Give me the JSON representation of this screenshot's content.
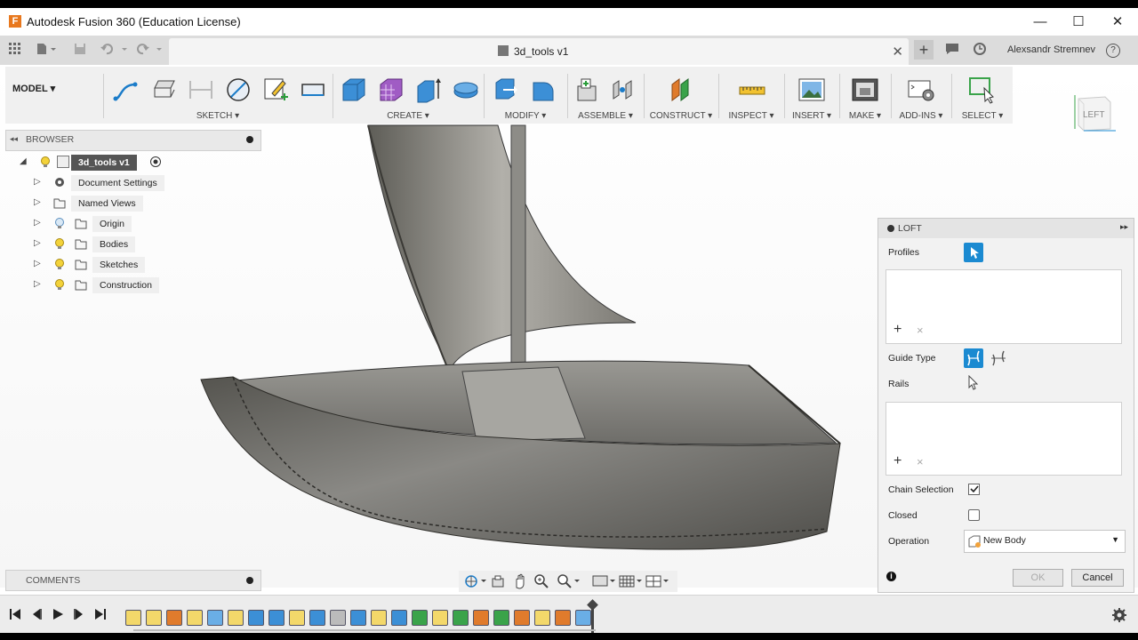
{
  "window": {
    "title": "Autodesk Fusion 360 (Education License)",
    "controls": {
      "minimize": "—",
      "maximize": "☐",
      "close": "✕"
    }
  },
  "tabbar": {
    "document_title": "3d_tools v1",
    "close_glyph": "✕",
    "new_tab_glyph": "+",
    "user_name": "Alexsandr Stremnev",
    "help_glyph": "?"
  },
  "toolbar": {
    "workspace": "MODEL ▾",
    "groups": [
      {
        "label": "SKETCH ▾"
      },
      {
        "label": "CREATE ▾"
      },
      {
        "label": "MODIFY ▾"
      },
      {
        "label": "ASSEMBLE ▾"
      },
      {
        "label": "CONSTRUCT ▾"
      },
      {
        "label": "INSPECT ▾"
      },
      {
        "label": "INSERT ▾"
      },
      {
        "label": "MAKE ▾"
      },
      {
        "label": "ADD-INS ▾"
      },
      {
        "label": "SELECT ▾"
      }
    ]
  },
  "viewcube": {
    "face_label": "LEFT"
  },
  "browser": {
    "title": "BROWSER",
    "root": "3d_tools v1",
    "items": [
      {
        "label": "Document Settings"
      },
      {
        "label": "Named Views"
      },
      {
        "label": "Origin"
      },
      {
        "label": "Bodies"
      },
      {
        "label": "Sketches"
      },
      {
        "label": "Construction"
      }
    ]
  },
  "comments": {
    "title": "COMMENTS"
  },
  "loft": {
    "title": "LOFT",
    "profiles_label": "Profiles",
    "guide_type_label": "Guide Type",
    "rails_label": "Rails",
    "add_glyph": "+",
    "remove_glyph": "×",
    "chain_selection_label": "Chain Selection",
    "chain_selection_checked": true,
    "closed_label": "Closed",
    "closed_checked": false,
    "operation_label": "Operation",
    "operation_value": "New Body",
    "ok_label": "OK",
    "cancel_label": "Cancel",
    "info_glyph": "i"
  },
  "colors": {
    "accent": "#1b8ad1",
    "toolbar_bg": "#f0f0f0",
    "boat_body": "#6b6b68",
    "sail": "#9c9a93"
  }
}
